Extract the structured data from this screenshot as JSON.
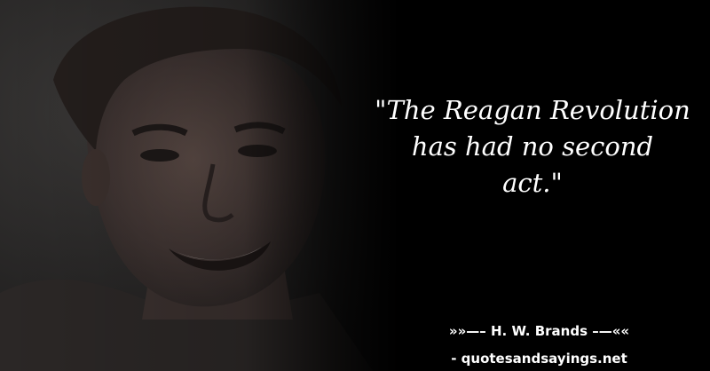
{
  "quote": {
    "lines": [
      "\"The Reagan Revolution",
      "has had no second",
      "act.\""
    ]
  },
  "author": {
    "text": "»»—– H. W. Brands –—««"
  },
  "site": {
    "text": "- quotesandsayings.net"
  }
}
